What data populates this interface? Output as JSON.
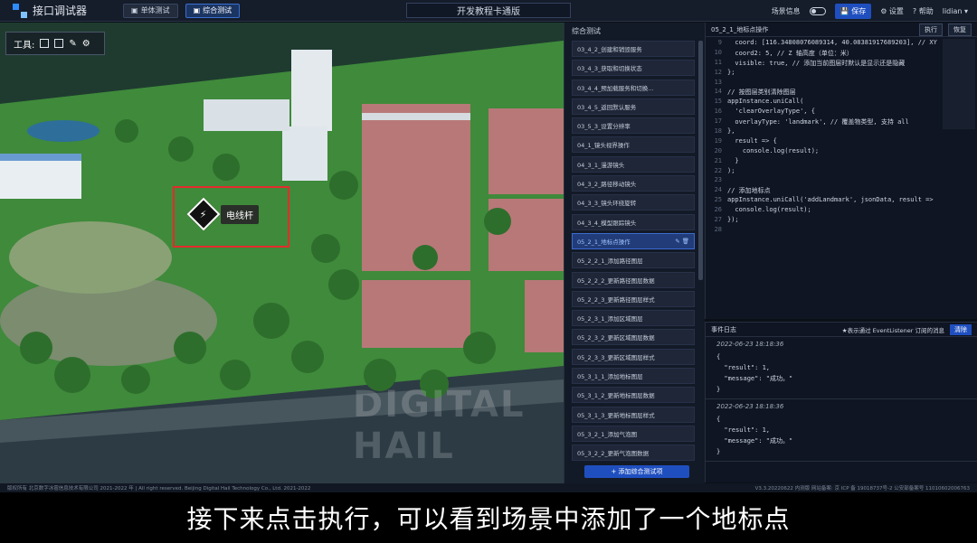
{
  "header": {
    "app_title": "接口调试器",
    "single_test_label": "单体测试",
    "combined_test_label": "综合测试",
    "center_title": "开发教程卡通版",
    "scene_info_label": "场景信息",
    "save_label": "保存",
    "settings_label": "设置",
    "help_label": "帮助",
    "user_label": "lidian"
  },
  "scene": {
    "tool_label": "工具:",
    "landmark_label": "电线杆",
    "landmark_icon": "utility-pole-icon",
    "watermark": "DIGITAL HAIL"
  },
  "list": {
    "title": "综合测试",
    "items": [
      "03_4_2_创建和销毁服务",
      "03_4_3_获取和切换状态",
      "03_4_4_预加载服务和切换...",
      "03_4_5_返回默认服务",
      "03_5_3_设置分辨率",
      "04_1_镜头视界操作",
      "04_3_1_漫游镜头",
      "04_3_2_路径移动镜头",
      "04_3_3_镜头环绕旋转",
      "04_3_4_模型跟踪镜头",
      "05_2_1_地标点操作",
      "05_2_2_1_添加路径图层",
      "05_2_2_2_更新路径图层数据",
      "05_2_2_3_更新路径图层样式",
      "05_2_3_1_添加区域图层",
      "05_2_3_2_更新区域图层数据",
      "05_2_3_3_更新区域图层样式",
      "05_3_1_1_添加地标图层",
      "05_3_1_2_更新地标图层数据",
      "05_3_1_3_更新地标图层样式",
      "05_3_2_1_添加气泡图",
      "05_3_2_2_更新气泡图数据"
    ],
    "active_index": 10,
    "add_button_label": "+ 添加综合测试项"
  },
  "code": {
    "title": "05_2_1_地标点操作",
    "run_label": "执行",
    "restore_label": "恢复",
    "lines": [
      {
        "n": "9",
        "t": "  coord: [116.34808076089314, 40.08381917689203], // XY"
      },
      {
        "n": "10",
        "t": "  coord2: 5, // Z 轴高度（单位：米）"
      },
      {
        "n": "11",
        "t": "  visible: true, // 添加当前图层时默认是显示还是隐藏"
      },
      {
        "n": "12",
        "t": "};"
      },
      {
        "n": "13",
        "t": ""
      },
      {
        "n": "14",
        "t": "// 按图层类别清除图层"
      },
      {
        "n": "15",
        "t": "appInstance.uniCall("
      },
      {
        "n": "16",
        "t": "  'clearOverlayType', {"
      },
      {
        "n": "17",
        "t": "  overlayType: 'landmark', // 覆盖物类型, 支持 all"
      },
      {
        "n": "18",
        "t": "},"
      },
      {
        "n": "19",
        "t": "  result => {"
      },
      {
        "n": "20",
        "t": "    console.log(result);"
      },
      {
        "n": "21",
        "t": "  }"
      },
      {
        "n": "22",
        "t": ");"
      },
      {
        "n": "23",
        "t": ""
      },
      {
        "n": "24",
        "t": "// 添加地标点"
      },
      {
        "n": "25",
        "t": "appInstance.uniCall('addLandmark', jsonData, result =>"
      },
      {
        "n": "26",
        "t": "  console.log(result);"
      },
      {
        "n": "27",
        "t": "});"
      },
      {
        "n": "28",
        "t": ""
      }
    ]
  },
  "log": {
    "title": "事件日志",
    "note": "★表示通过 EventListener 订阅的消息",
    "clear_label": "清除",
    "entries": [
      {
        "ts": "2022-06-23 18:18:36",
        "body": "{\n  \"result\": 1,\n  \"message\": \"成功。\"\n}"
      },
      {
        "ts": "2022-06-23 18:18:36",
        "body": "{\n  \"result\": 1,\n  \"message\": \"成功。\"\n}"
      }
    ]
  },
  "footer": {
    "left": "版权所有 北京数字冰雹信息技术有限公司 2021-2022 年 | All right reserved. Beijing Digital Hail Technology Co., Ltd. 2021-2022",
    "right": "V3.3.20220622 内测版  网站备案: 京 ICP 备 19018737号-2 公安部备案号 11010602006763"
  },
  "subtitle": "接下来点击执行，可以看到场景中添加了一个地标点"
}
